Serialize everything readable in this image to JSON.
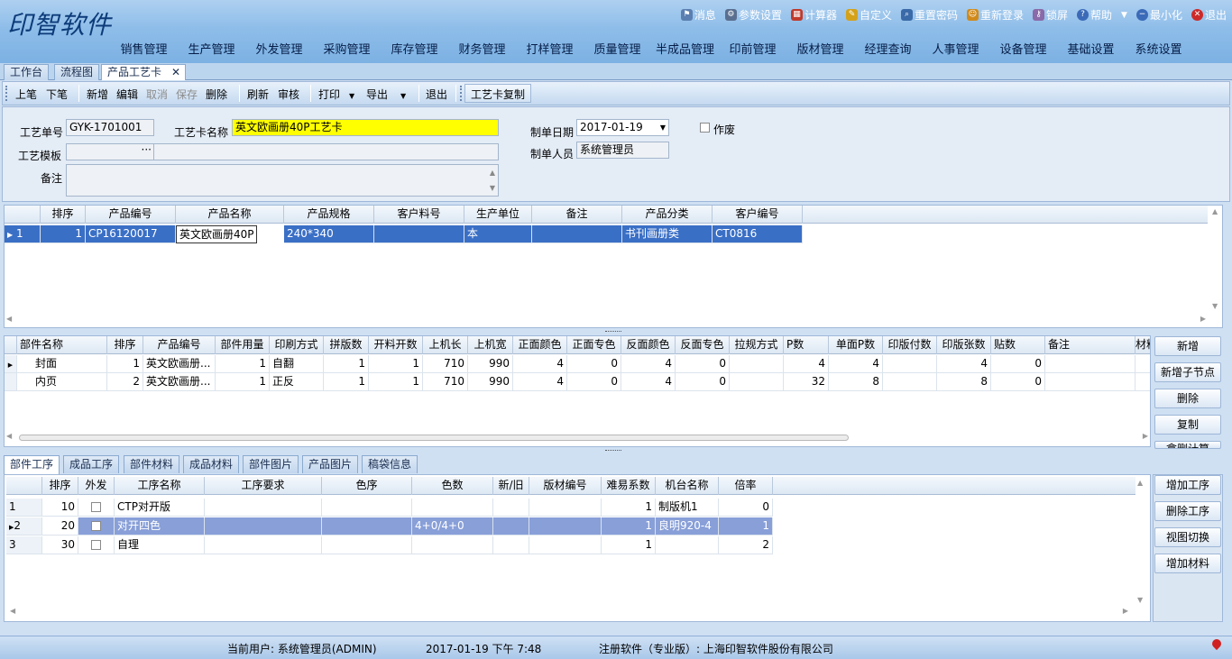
{
  "app": {
    "logo_text": "印智软件"
  },
  "sysbar": [
    {
      "label": "消息",
      "icon": "flag-icon",
      "color": "#5b7fb0"
    },
    {
      "label": "参数设置",
      "icon": "gear-icon",
      "color": "#5a6f8f"
    },
    {
      "label": "计算器",
      "icon": "calculator-icon",
      "color": "#c0392b"
    },
    {
      "label": "自定义",
      "icon": "notepad-icon",
      "color": "#d4a21a"
    },
    {
      "label": "重置密码",
      "icon": "magnifier-icon",
      "color": "#3b6aa8"
    },
    {
      "label": "重新登录",
      "icon": "users-icon",
      "color": "#d08a1a"
    },
    {
      "label": "锁屏",
      "icon": "key-icon",
      "color": "#8a6aa8"
    },
    {
      "label": "帮助",
      "icon": "help-icon",
      "color": "#3b6ab8"
    },
    {
      "label": "最小化",
      "icon": "minimize-icon",
      "color": "#3b6ab8"
    },
    {
      "label": "退出",
      "icon": "close-icon",
      "color": "#cc2a2a"
    }
  ],
  "menu": [
    "销售管理",
    "生产管理",
    "外发管理",
    "采购管理",
    "库存管理",
    "财务管理",
    "打样管理",
    "质量管理",
    "半成品管理",
    "印前管理",
    "版材管理",
    "经理查询",
    "人事管理",
    "设备管理",
    "基础设置",
    "系统设置"
  ],
  "doc_tabs": [
    "工作台",
    "流程图",
    "产品工艺卡"
  ],
  "toolbar": {
    "prev": "上笔",
    "next": "下笔",
    "add": "新增",
    "edit": "编辑",
    "cancel": "取消",
    "save": "保存",
    "delete": "删除",
    "refresh": "刷新",
    "audit": "审核",
    "print": "打印",
    "export": "导出",
    "exit": "退出",
    "copy_card": "工艺卡复制"
  },
  "form": {
    "order_no_label": "工艺单号",
    "order_no": "GYK-1701001",
    "card_name_label": "工艺卡名称",
    "card_name": "英文欧画册40P工艺卡",
    "date_label": "制单日期",
    "date": "2017-01-19",
    "void_label": "作废",
    "template_label": "工艺模板",
    "template_btn": "···",
    "creator_label": "制单人员",
    "creator": "系统管理员",
    "remark_label": "备注"
  },
  "product_grid": {
    "headers": [
      "排序",
      "产品编号",
      "产品名称",
      "产品规格",
      "客户料号",
      "生产单位",
      "备注",
      "产品分类",
      "客户编号"
    ],
    "rows": [
      {
        "idx": "1",
        "sort": "1",
        "code": "CP16120017",
        "name": "英文欧画册40P",
        "spec": "240*340",
        "cust_part": "",
        "unit": "本",
        "remark": "",
        "category": "书刊画册类",
        "cust_code": "CT0816"
      }
    ]
  },
  "parts_grid": {
    "headers": [
      "部件名称",
      "排序",
      "产品编号",
      "部件用量",
      "印刷方式",
      "拼版数",
      "开料开数",
      "上机长",
      "上机宽",
      "正面颜色",
      "正面专色",
      "反面颜色",
      "反面专色",
      "拉规方式",
      "P数",
      "单面P数",
      "印版付数",
      "印版张数",
      "贴数",
      "备注",
      "材料"
    ],
    "rows": [
      [
        "封面",
        "1",
        "英文欧画册...",
        "1",
        "自翻",
        "1",
        "1",
        "710",
        "990",
        "4",
        "0",
        "4",
        "0",
        "",
        "4",
        "4",
        "",
        "4",
        "0",
        "",
        ""
      ],
      [
        "内页",
        "2",
        "英文欧画册...",
        "1",
        "正反",
        "1",
        "1",
        "710",
        "990",
        "4",
        "0",
        "4",
        "0",
        "",
        "32",
        "8",
        "",
        "8",
        "0",
        "",
        ""
      ]
    ]
  },
  "parts_buttons": [
    "新增",
    "新增子节点",
    "删除",
    "复制",
    "拿删计算"
  ],
  "bottom_tabs": [
    "部件工序",
    "成品工序",
    "部件材料",
    "成品材料",
    "部件图片",
    "产品图片",
    "稿袋信息"
  ],
  "process_grid": {
    "headers": [
      "排序",
      "外发",
      "工序名称",
      "工序要求",
      "色序",
      "色数",
      "新/旧",
      "版材编号",
      "难易系数",
      "机台名称",
      "倍率"
    ],
    "rows": [
      {
        "idx": "1",
        "sort": "10",
        "name": "CTP对开版",
        "req": "",
        "seq": "",
        "colors": "",
        "new": "",
        "plate": "",
        "diff": "1",
        "machine": "制版机1",
        "rate": "0"
      },
      {
        "idx": "2",
        "sort": "20",
        "name": "对开四色",
        "req": "",
        "seq": "",
        "colors": "4+0/4+0",
        "new": "",
        "plate": "",
        "diff": "1",
        "machine": "良明920-4",
        "rate": "1"
      },
      {
        "idx": "3",
        "sort": "30",
        "name": "自理",
        "req": "",
        "seq": "",
        "colors": "",
        "new": "",
        "plate": "",
        "diff": "1",
        "machine": "",
        "rate": "2"
      }
    ]
  },
  "process_buttons": [
    "增加工序",
    "删除工序",
    "视图切换",
    "增加材料"
  ],
  "status": {
    "user": "当前用户: 系统管理员(ADMIN)",
    "datetime": "2017-01-19 下午 7:48",
    "registered": "注册软件（专业版）: 上海印智软件股份有限公司"
  }
}
